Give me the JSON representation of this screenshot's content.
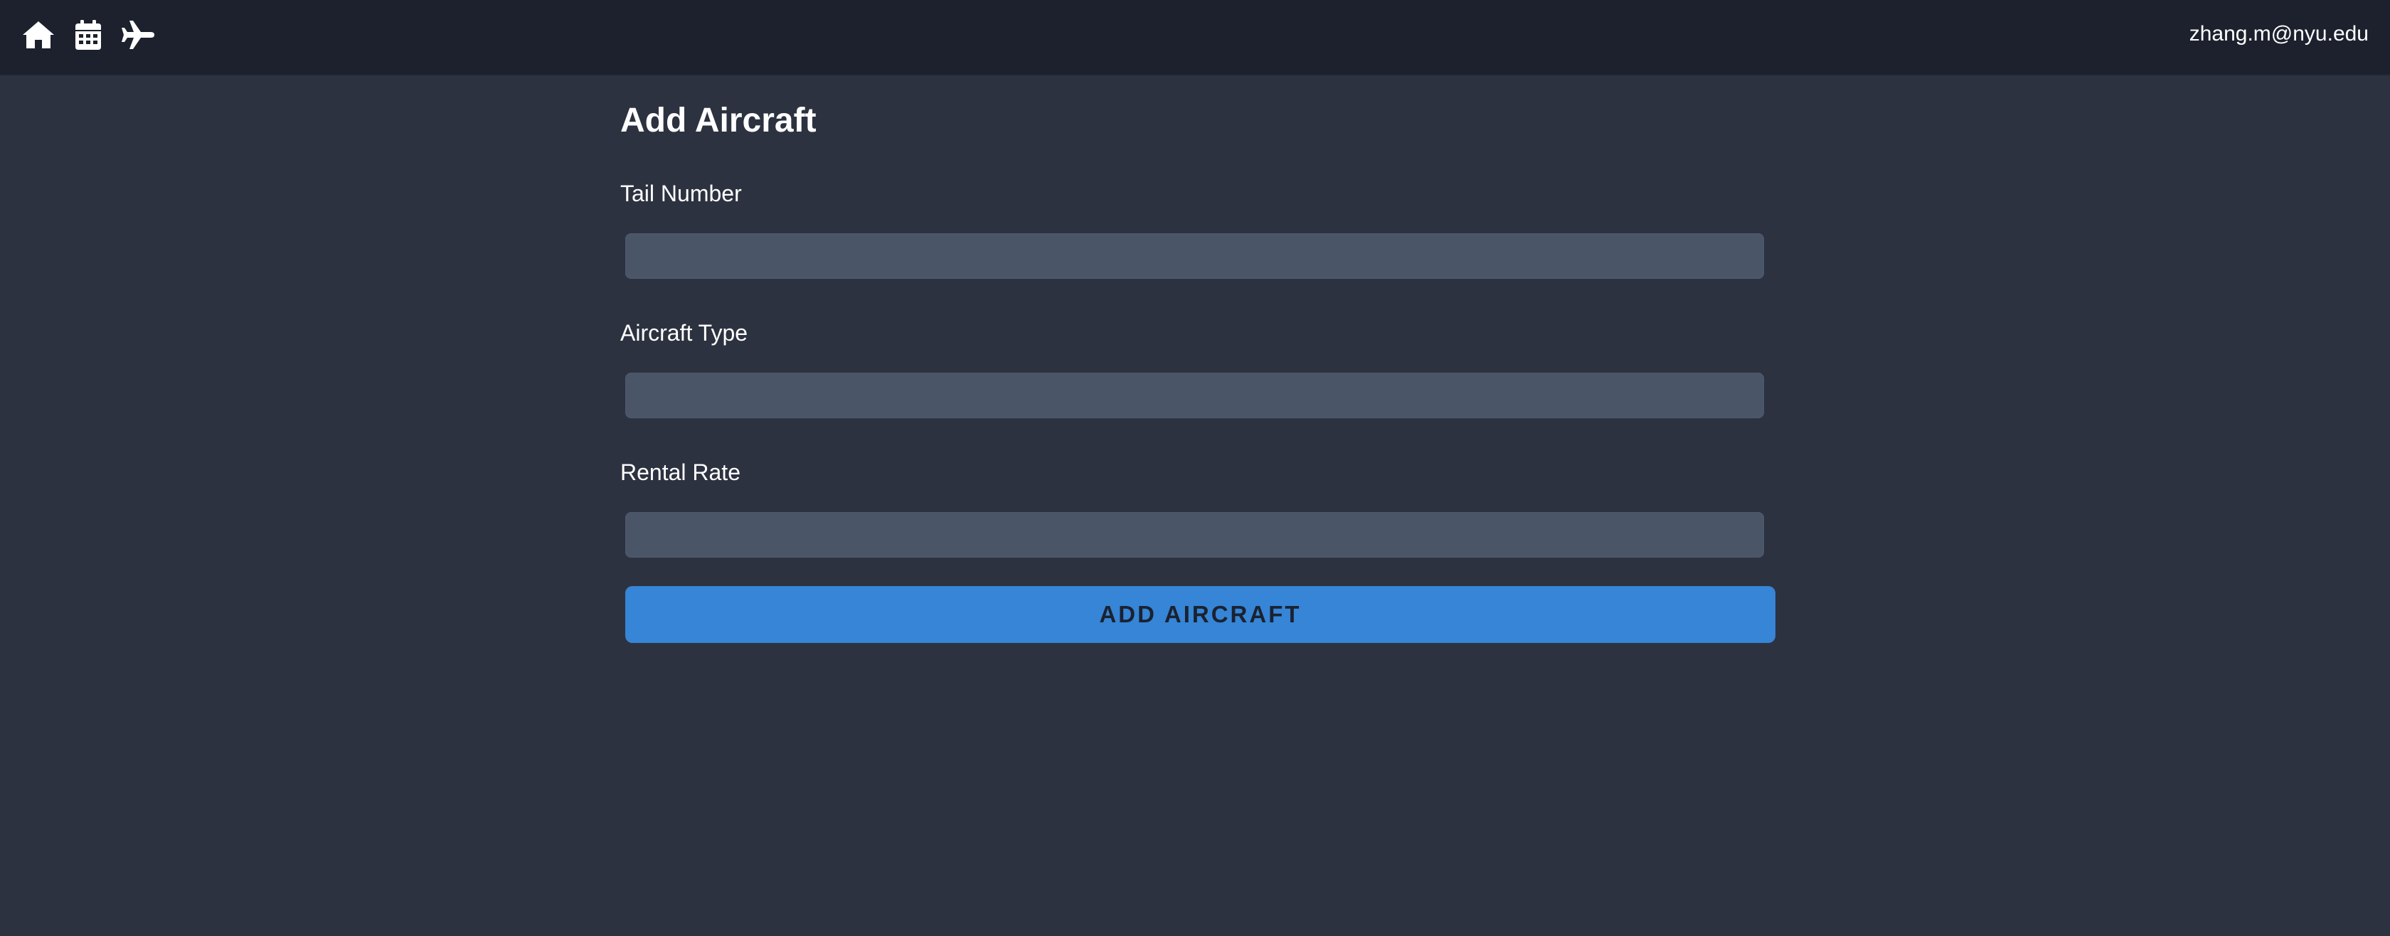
{
  "header": {
    "icons": [
      "home-icon",
      "calendar-icon",
      "airplane-icon"
    ],
    "user_email": "zhang.m@nyu.edu"
  },
  "form": {
    "title": "Add Aircraft",
    "fields": [
      {
        "label": "Tail Number",
        "value": "",
        "placeholder": ""
      },
      {
        "label": "Aircraft Type",
        "value": "",
        "placeholder": ""
      },
      {
        "label": "Rental Rate",
        "value": "",
        "placeholder": ""
      }
    ],
    "submit_label": "ADD AIRCRAFT"
  },
  "colors": {
    "topbar": "#1c212d",
    "background": "#2d3240",
    "input": "#4a5568",
    "button": "#3685d6",
    "button_text": "#1a2230"
  }
}
